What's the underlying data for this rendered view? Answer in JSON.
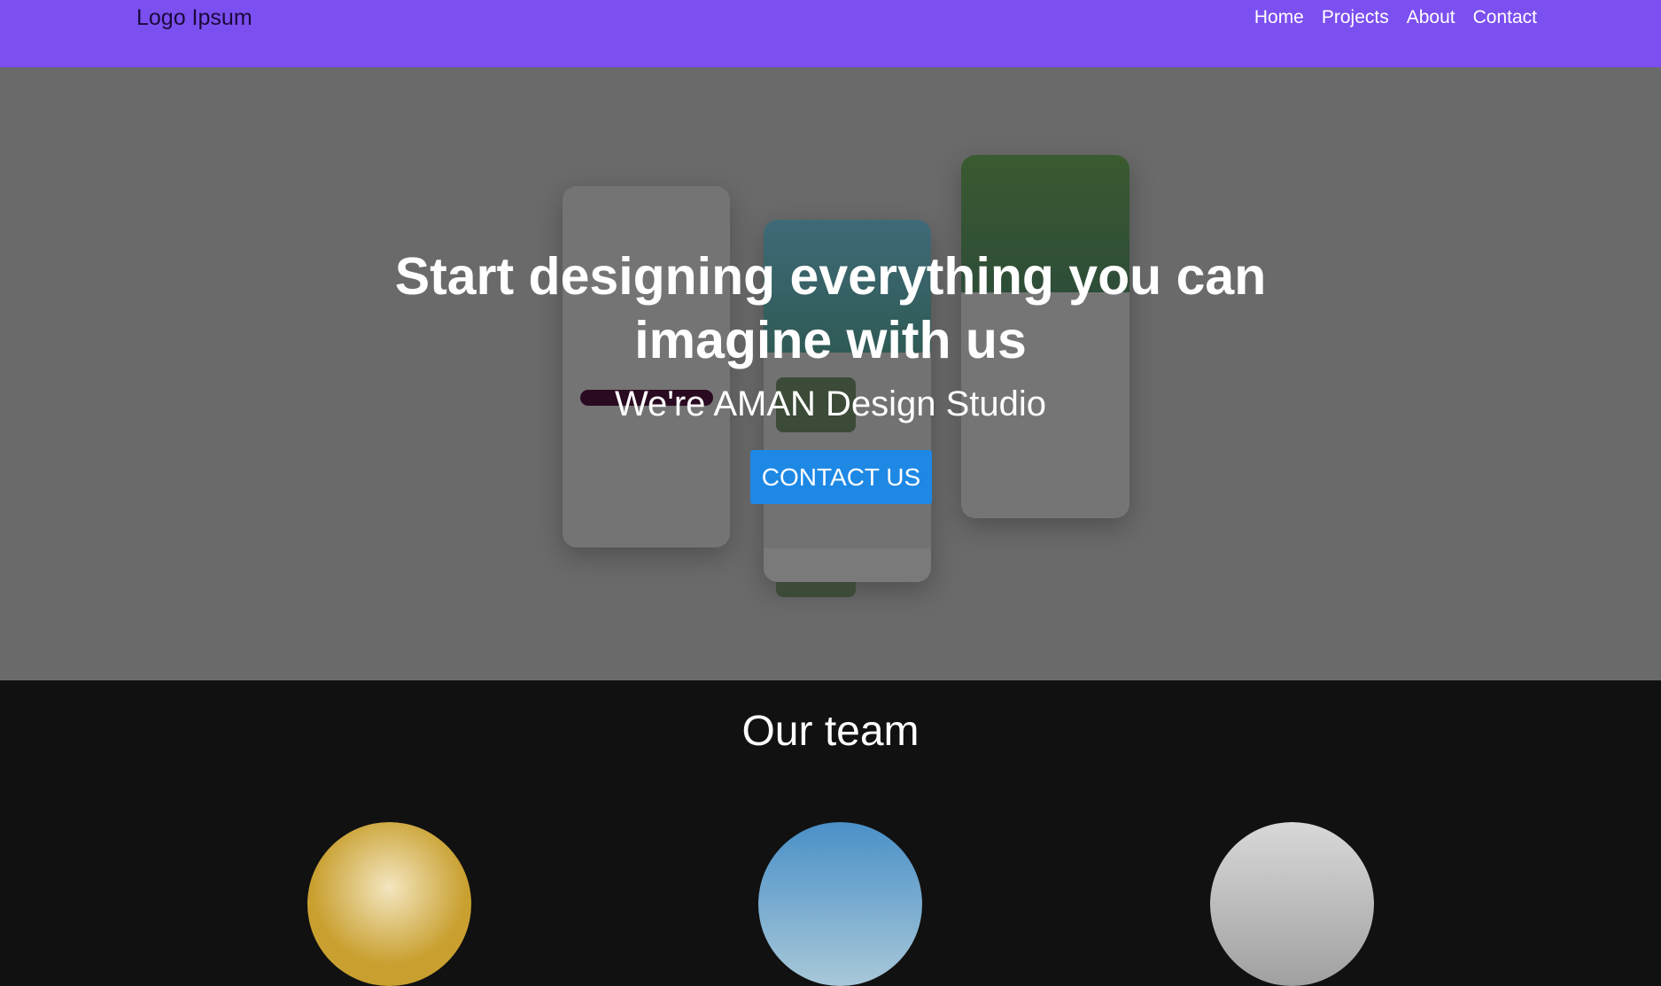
{
  "nav": {
    "logo": "Logo Ipsum",
    "links": [
      "Home",
      "Projects",
      "About",
      "Contact"
    ]
  },
  "hero": {
    "title": "Start designing everything you can imagine with us",
    "subtitle": "We're AMAN Design Studio",
    "cta": "CONTACT US"
  },
  "team": {
    "heading": "Our team"
  },
  "colors": {
    "nav": "#7c4ff0",
    "cta": "#1e88e5"
  }
}
